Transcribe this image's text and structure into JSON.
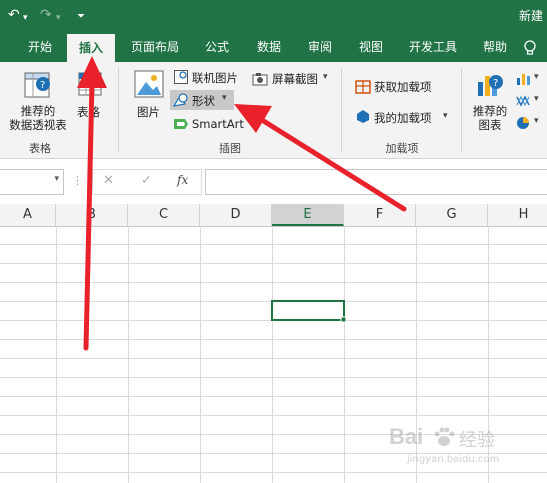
{
  "quick_access": {
    "undo_icon": "undo-icon",
    "redo_icon": "redo-icon",
    "customize_icon": "customize-icon"
  },
  "window_title": "新建",
  "tabs": [
    "开始",
    "插入",
    "页面布局",
    "公式",
    "数据",
    "审阅",
    "视图",
    "开发工具",
    "帮助"
  ],
  "active_tab": "插入",
  "ribbon": {
    "tables": {
      "recommended_pivot": "推荐的\n数据透视表",
      "recommended_pivot_line1": "推荐的",
      "recommended_pivot_line2": "数据透视表",
      "table": "表格",
      "group_label": "表格"
    },
    "illustrations": {
      "pictures": "图片",
      "online_pictures": "联机图片",
      "shapes": "形状",
      "smartart": "SmartArt",
      "screenshot": "屏幕截图",
      "group_label": "插图"
    },
    "addins": {
      "get_addins": "获取加载项",
      "my_addins": "我的加载项",
      "group_label": "加载项"
    },
    "charts": {
      "recommended_charts_line1": "推荐的",
      "recommended_charts_line2": "图表"
    }
  },
  "formula_bar": {
    "cancel": "✕",
    "enter": "✓",
    "fx": "fx",
    "value": ""
  },
  "columns": [
    "A",
    "B",
    "C",
    "D",
    "E",
    "F",
    "G",
    "H"
  ],
  "selected_column": "E",
  "watermark": {
    "brand": "Bai",
    "brand2": "经验",
    "url": "jingyan.baidu.com"
  },
  "colors": {
    "excel_green": "#217346",
    "arrow_red": "#e8212b"
  }
}
